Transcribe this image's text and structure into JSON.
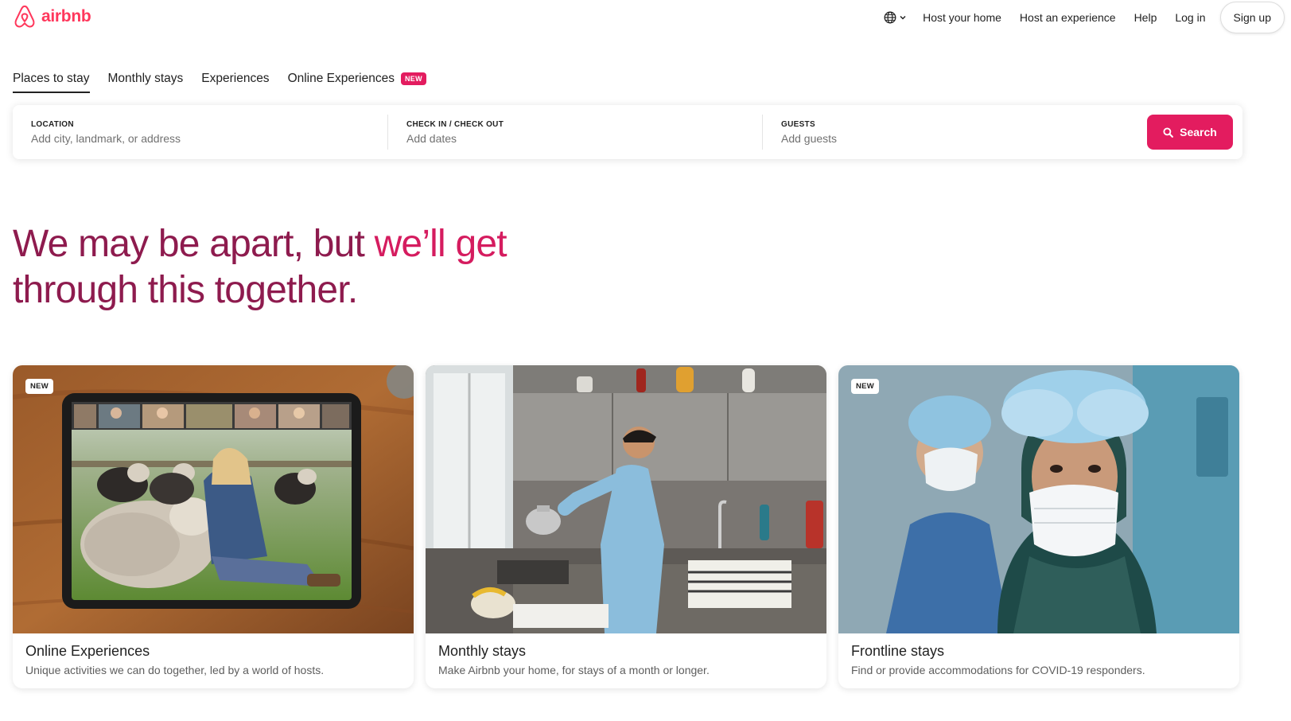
{
  "brand": {
    "name": "airbnb",
    "color": "#FF385C"
  },
  "header": {
    "globe_icon": "globe-icon",
    "links": [
      "Host your home",
      "Host an experience",
      "Help",
      "Log in"
    ],
    "signup_label": "Sign up"
  },
  "tabs": [
    {
      "label": "Places to stay",
      "active": true
    },
    {
      "label": "Monthly stays"
    },
    {
      "label": "Experiences"
    },
    {
      "label": "Online Experiences",
      "badge": "NEW"
    }
  ],
  "search": {
    "location_label": "LOCATION",
    "location_placeholder": "Add city, landmark, or address",
    "dates_label": "CHECK IN / CHECK OUT",
    "dates_placeholder": "Add dates",
    "guests_label": "GUESTS",
    "guests_placeholder": "Add guests",
    "button_label": "Search",
    "button_color": "#E31C5F"
  },
  "hero": {
    "part1": "We may be apart, but ",
    "part2": "we’ll get",
    "line2": "through this together.",
    "color_primary": "#8E1B4E",
    "color_accent": "#D51C5F"
  },
  "cards": [
    {
      "title": "Online Experiences",
      "description": "Unique activities we can do together, led by a world of hosts.",
      "badge": "NEW",
      "image": "tablet-video-call-with-sheep"
    },
    {
      "title": "Monthly stays",
      "description": "Make Airbnb your home, for stays of a month or longer.",
      "badge": "",
      "image": "man-in-kitchen-with-kettle"
    },
    {
      "title": "Frontline stays",
      "description": "Find or provide accommodations for COVID-19 responders.",
      "badge": "NEW",
      "image": "medical-workers-in-masks"
    }
  ]
}
